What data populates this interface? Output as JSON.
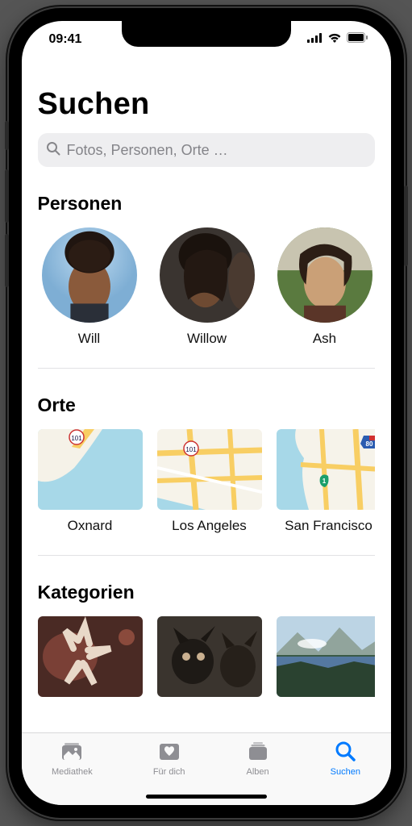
{
  "status": {
    "time": "09:41"
  },
  "page": {
    "title": "Suchen"
  },
  "search": {
    "placeholder": "Fotos, Personen, Orte …"
  },
  "sections": {
    "people": {
      "heading": "Personen",
      "items": [
        {
          "name": "Will"
        },
        {
          "name": "Willow"
        },
        {
          "name": "Ash"
        }
      ]
    },
    "places": {
      "heading": "Orte",
      "items": [
        {
          "name": "Oxnard"
        },
        {
          "name": "Los Angeles"
        },
        {
          "name": "San Francisco"
        }
      ]
    },
    "categories": {
      "heading": "Kategorien"
    }
  },
  "tabs": {
    "library": "Mediathek",
    "foryou": "Für dich",
    "albums": "Alben",
    "search": "Suchen"
  },
  "colors": {
    "accent": "#007aff"
  }
}
